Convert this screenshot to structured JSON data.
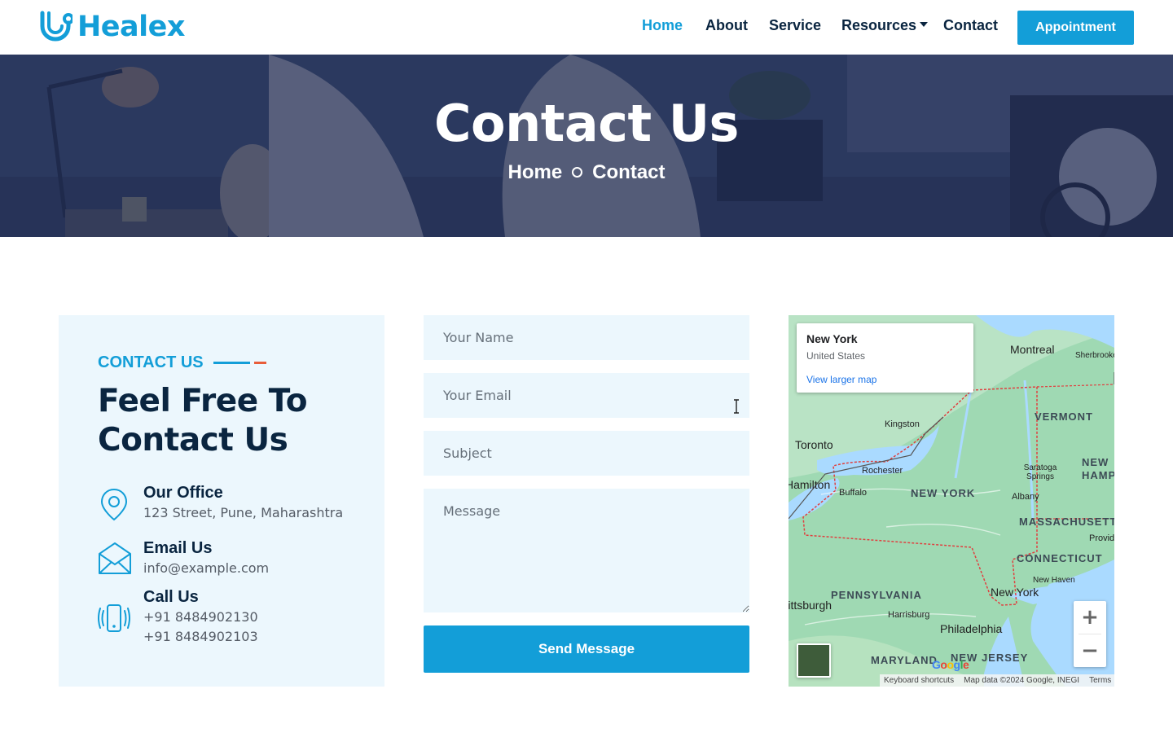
{
  "brand": {
    "name": "Healex",
    "color": "#139ed8"
  },
  "nav": {
    "items": [
      {
        "label": "Home",
        "active": true
      },
      {
        "label": "About"
      },
      {
        "label": "Service"
      },
      {
        "label": "Resources",
        "dropdown": true
      },
      {
        "label": "Contact"
      }
    ],
    "appointment_label": "Appointment"
  },
  "hero": {
    "title": "Contact Us",
    "breadcrumb": {
      "home": "Home",
      "current": "Contact"
    }
  },
  "contact_info": {
    "tag": "CONTACT US",
    "heading": "Feel Free To Contact Us",
    "office": {
      "title": "Our Office",
      "value": "123 Street, Pune, Maharashtra",
      "icon": "location-pin-icon"
    },
    "email": {
      "title": "Email Us",
      "value": "info@example.com",
      "icon": "envelope-icon"
    },
    "call": {
      "title": "Call Us",
      "phones": [
        "+91 8484902130",
        "+91 8484902103"
      ],
      "icon": "phone-vibrate-icon"
    }
  },
  "form": {
    "name_placeholder": "Your Name",
    "email_placeholder": "Your Email",
    "subject_placeholder": "Subject",
    "message_placeholder": "Message",
    "submit_label": "Send Message"
  },
  "map": {
    "info": {
      "title": "New York",
      "subtitle": "United States",
      "link": "View larger map"
    },
    "cities": [
      "Montreal",
      "Sherbrooke",
      "Kingston",
      "Toronto",
      "Rochester",
      "Buffalo",
      "Hamilton",
      "Saratoga Springs",
      "Albany",
      "Providence",
      "New Haven",
      "New York",
      "Harrisburg",
      "Philadelphia",
      "Pittsburgh"
    ],
    "states": [
      "VERMONT",
      "NEW HAMPSHIRE",
      "NEW YORK",
      "MASSACHUSETTS",
      "CONNECTICUT",
      "PENNSYLVANIA",
      "MARYLAND",
      "NEW JERSEY"
    ],
    "zoom_in": "+",
    "zoom_out": "−",
    "attribution": {
      "shortcuts": "Keyboard shortcuts",
      "data": "Map data ©2024 Google, INEGI",
      "terms": "Terms"
    },
    "google": "Google"
  },
  "colors": {
    "accent": "#139ed8",
    "accent_secondary": "#e85d3a",
    "card_bg": "#ecf7fd",
    "dark_text": "#0a2540"
  }
}
